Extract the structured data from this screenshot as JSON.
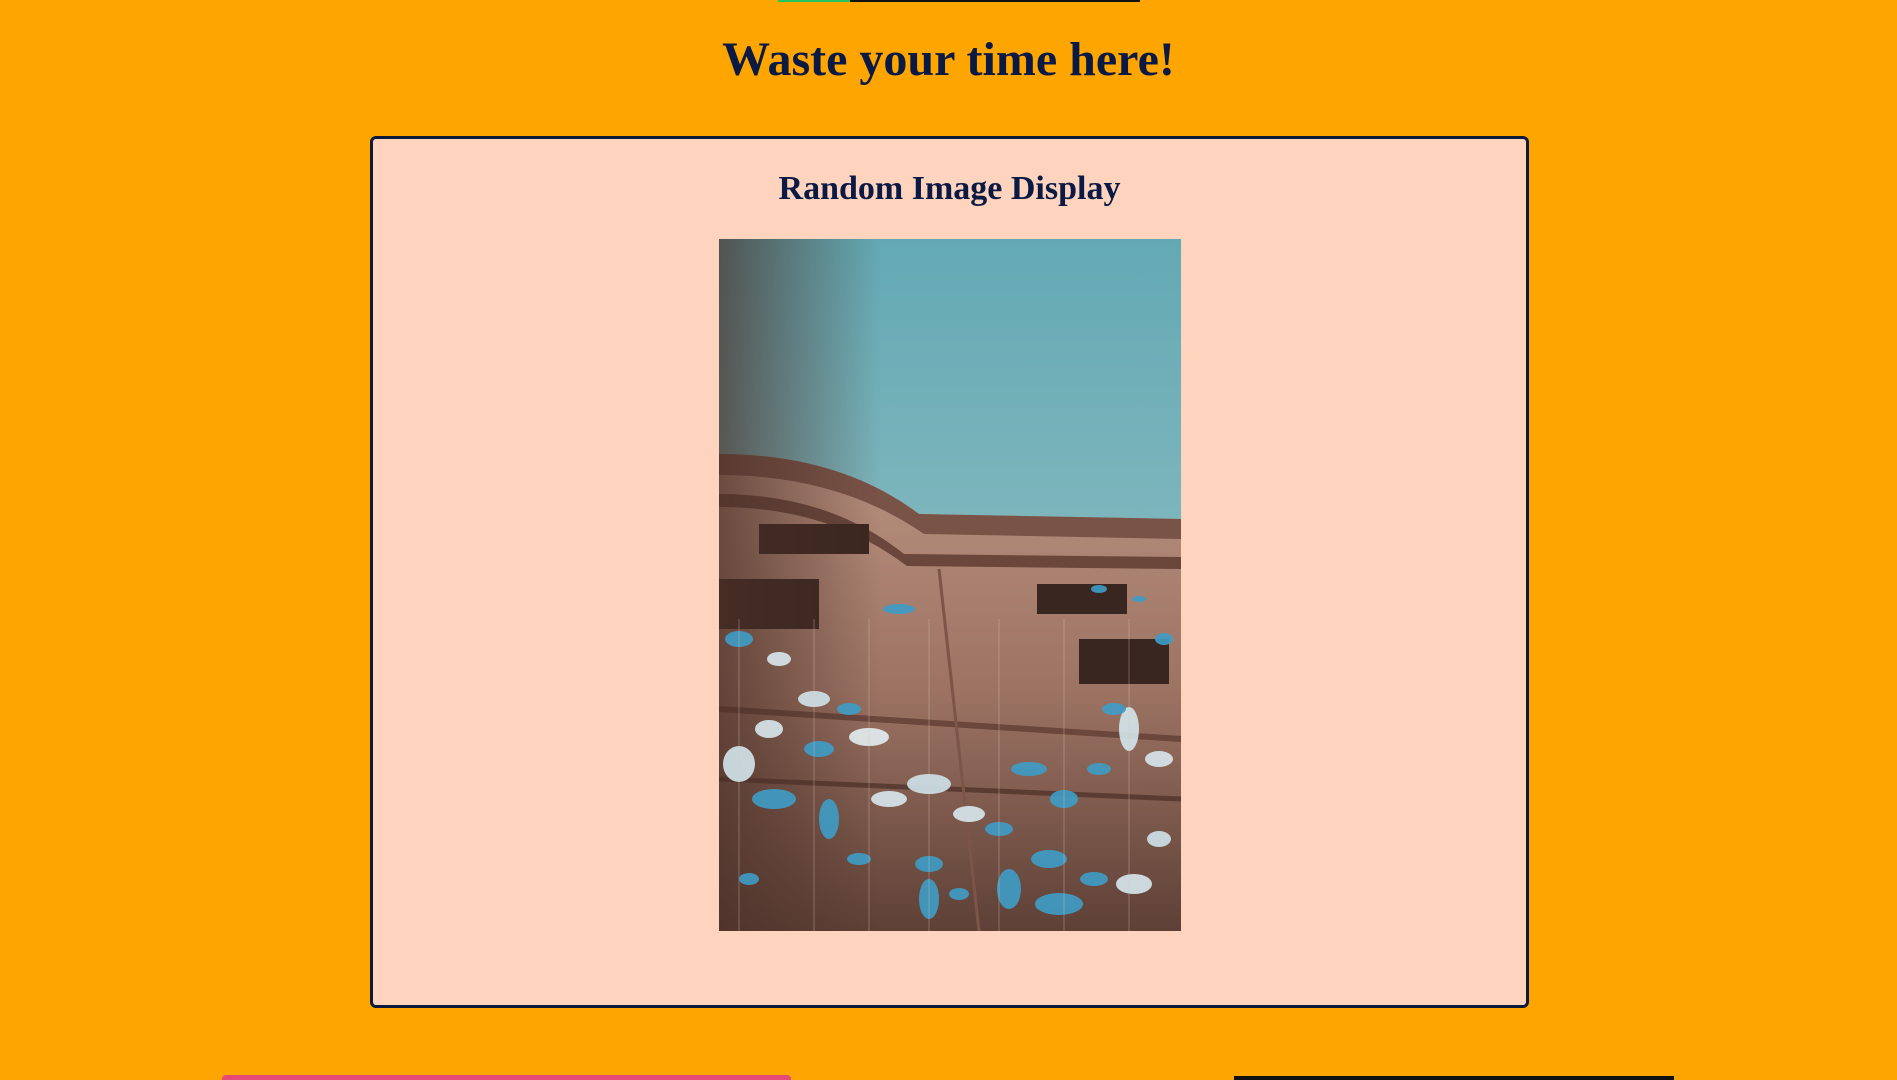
{
  "page": {
    "title": "Waste your time here!",
    "background_color": "#FFA500",
    "title_color": "#0B1A45"
  },
  "top_progress": {
    "fraction": 0.2,
    "fill_color": "#22C55E",
    "track_color": "#111111"
  },
  "card": {
    "title": "Random Image Display",
    "background_color": "#FFD4BE",
    "border_color": "#0B1A3A"
  },
  "image": {
    "alt_icon": "photo-image"
  },
  "bottom_elements": {
    "left_bar_color": "#E64A78",
    "right_bar_color": "#111111"
  }
}
